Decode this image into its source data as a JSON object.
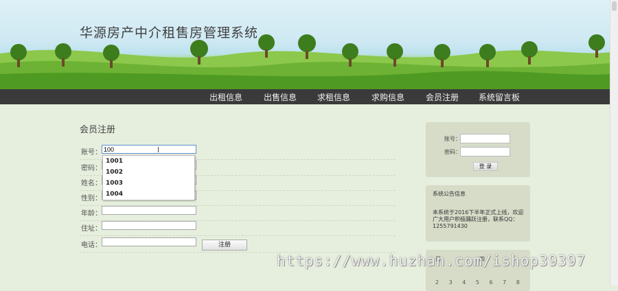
{
  "header": {
    "title": "华源房产中介租售房管理系统"
  },
  "nav": {
    "items": [
      "出租信息",
      "出售信息",
      "求租信息",
      "求购信息",
      "会员注册",
      "系统留言板"
    ]
  },
  "register": {
    "title": "会员注册",
    "fields": [
      {
        "label": "账号：",
        "value": "100"
      },
      {
        "label": "密码：",
        "value": ""
      },
      {
        "label": "姓名：",
        "value": ""
      },
      {
        "label": "性别：",
        "value": ""
      },
      {
        "label": "年龄：",
        "value": ""
      },
      {
        "label": "住址：",
        "value": ""
      },
      {
        "label": "电话：",
        "value": ""
      }
    ],
    "submit_label": "注册",
    "autocomplete": [
      "1001",
      "1002",
      "1003",
      "1004"
    ]
  },
  "login": {
    "account_label": "账号：",
    "password_label": "密码：",
    "button_label": "登 录"
  },
  "notice": {
    "title": "系统公告信息",
    "text": "本系统于2016下半年正式上线，欢迎广大用户积极踊跃注册，联系QQ：1255791430"
  },
  "calendar": {
    "left_label": "日",
    "right_label": "四",
    "days": "2 3 4 5 6 7 8"
  },
  "watermark": "https://www.huzhan.com/ishop39397"
}
